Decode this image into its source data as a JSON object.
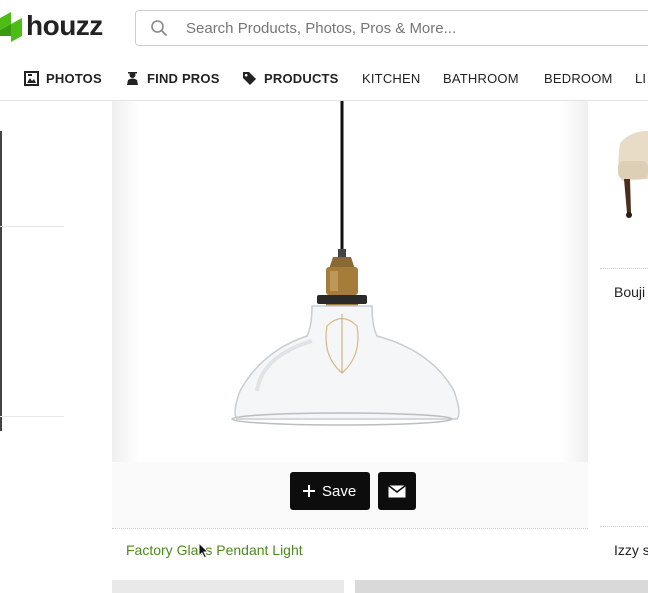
{
  "header": {
    "logo_text": "houzz",
    "search_placeholder": "Search Products, Photos, Pros & More..."
  },
  "nav": {
    "items": [
      {
        "label": "PHOTOS",
        "icon": "photos-icon"
      },
      {
        "label": "FIND PROS",
        "icon": "pro-icon"
      },
      {
        "label": "PRODUCTS",
        "icon": "tag-icon"
      },
      {
        "label": "KITCHEN"
      },
      {
        "label": "BATHROOM"
      },
      {
        "label": "BEDROOM"
      },
      {
        "label": "LI"
      }
    ]
  },
  "main_card": {
    "save_label": "Save",
    "title": "Factory Glass Pendant Light"
  },
  "right_card": {
    "items": [
      "Bouji",
      "Izzy s"
    ]
  },
  "colors": {
    "brand_green": "#4dbc15",
    "title_green": "#4a8c1c",
    "button_black": "#0d0d0d"
  }
}
